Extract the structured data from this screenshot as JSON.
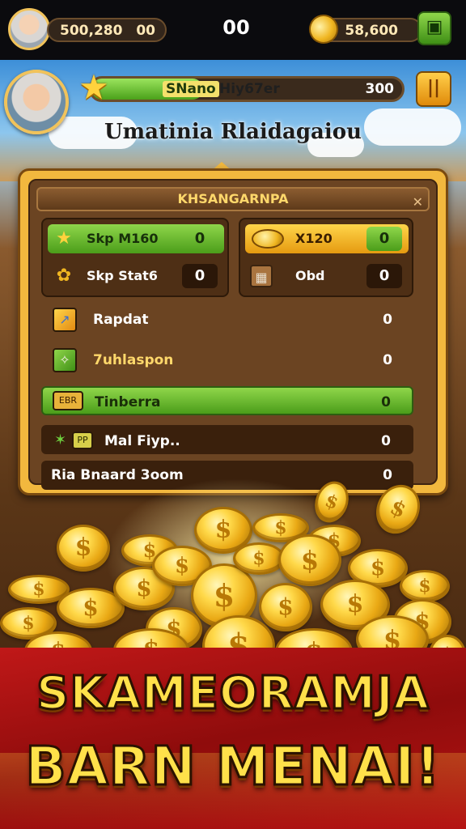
{
  "topbar": {
    "currency_value": "500,280",
    "currency_value2": "00",
    "center_value": "00",
    "coins_value": "58,600",
    "shop_icon": "shop-bag-icon"
  },
  "header": {
    "player_badge": "SNano",
    "player_name": "Hiy67er",
    "score": "300",
    "xp_progress": 0.36,
    "subtitle": "Umatinia Rlaidagaiou"
  },
  "panel": {
    "title": "KHSANGARNPA",
    "stats_left": [
      {
        "icon": "star-icon",
        "label": "Skp M160",
        "value": "0"
      },
      {
        "icon": "bell-icon",
        "label": "Skp Stat6",
        "value": "0"
      }
    ],
    "stats_right": [
      {
        "icon": "coin-icon",
        "label": "X120",
        "value": "0"
      },
      {
        "icon": "crate-icon",
        "label": "Obd",
        "value": "0"
      }
    ],
    "rows": [
      {
        "icon": "sword-icon",
        "badge": "",
        "label": "Rapdat",
        "value": "0"
      },
      {
        "icon": "scroll-icon",
        "badge": "",
        "label": "7uhlaspon",
        "value": "0"
      },
      {
        "icon": "ticket-icon",
        "badge": "EBR",
        "label": "Tinberra",
        "value": "0"
      },
      {
        "icon": "star-small-icon",
        "badge": "PP",
        "label": "Mal Fiyp..",
        "value": "0"
      },
      {
        "icon": "",
        "badge": "",
        "label": "Ria Bnaard 3oom",
        "value": "0"
      }
    ]
  },
  "banner": {
    "line1": "SKAMEORAMJA",
    "line2": "BARN MENAI!"
  },
  "colors": {
    "gold": "#f2b83e",
    "green": "#4aa11a",
    "brown": "#6b4422",
    "red": "#c01818",
    "title_yellow": "#ffe14a"
  }
}
